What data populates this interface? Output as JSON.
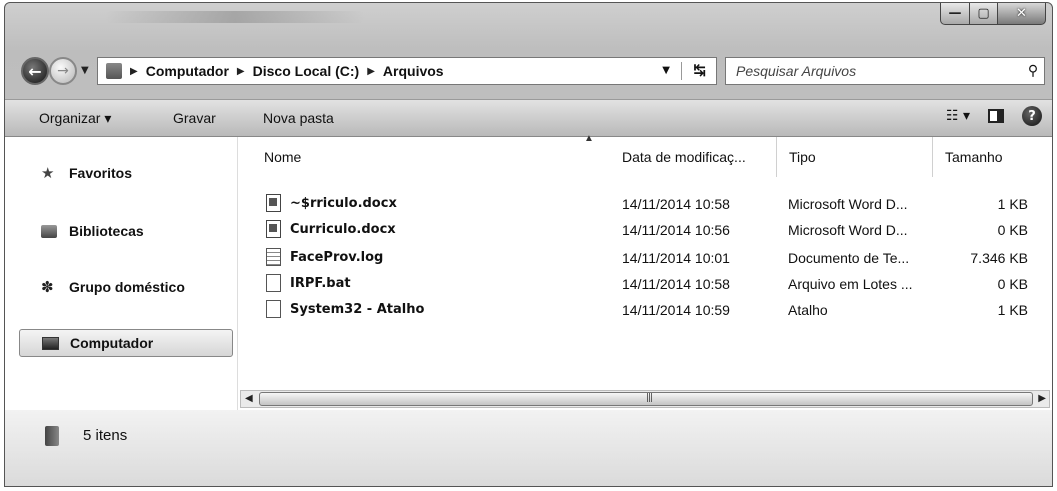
{
  "window": {
    "controls": {
      "minimize": "—",
      "maximize": "▢",
      "close": "✕"
    }
  },
  "nav": {
    "back_icon": "arrow-left-icon",
    "forward_icon": "arrow-right-icon"
  },
  "address": {
    "crumbs": [
      "Computador",
      "Disco Local (C:)",
      "Arquivos"
    ]
  },
  "search": {
    "placeholder": "Pesquisar Arquivos"
  },
  "toolbar": {
    "organize_label": "Organizar ▾",
    "burn_label": "Gravar",
    "new_folder_label": "Nova pasta"
  },
  "sidebar": {
    "items": [
      {
        "label": "Favoritos",
        "icon": "star-icon"
      },
      {
        "label": "Bibliotecas",
        "icon": "library-icon"
      },
      {
        "label": "Grupo doméstico",
        "icon": "homegroup-icon"
      },
      {
        "label": "Computador",
        "icon": "computer-icon",
        "selected": true
      }
    ]
  },
  "filelist": {
    "columns": [
      "Nome",
      "Data de modificaç...",
      "Tipo",
      "Tamanho"
    ],
    "rows": [
      {
        "name": "~$rriculo.docx",
        "date": "14/11/2014 10:58",
        "type": "Microsoft Word D...",
        "size": "1 KB",
        "icon": "word-doc-icon"
      },
      {
        "name": "Curriculo.docx",
        "date": "14/11/2014 10:56",
        "type": "Microsoft Word D...",
        "size": "0 KB",
        "icon": "word-doc-icon"
      },
      {
        "name": "FaceProv.log",
        "date": "14/11/2014 10:01",
        "type": "Documento de Te...",
        "size": "7.346 KB",
        "icon": "text-file-icon"
      },
      {
        "name": "IRPF.bat",
        "date": "14/11/2014 10:58",
        "type": "Arquivo em Lotes ...",
        "size": "0 KB",
        "icon": "blank-file-icon"
      },
      {
        "name": "System32 - Atalho",
        "date": "14/11/2014 10:59",
        "type": "Atalho",
        "size": "1 KB",
        "icon": "blank-file-icon"
      }
    ]
  },
  "status": {
    "item_count": "5 itens"
  }
}
